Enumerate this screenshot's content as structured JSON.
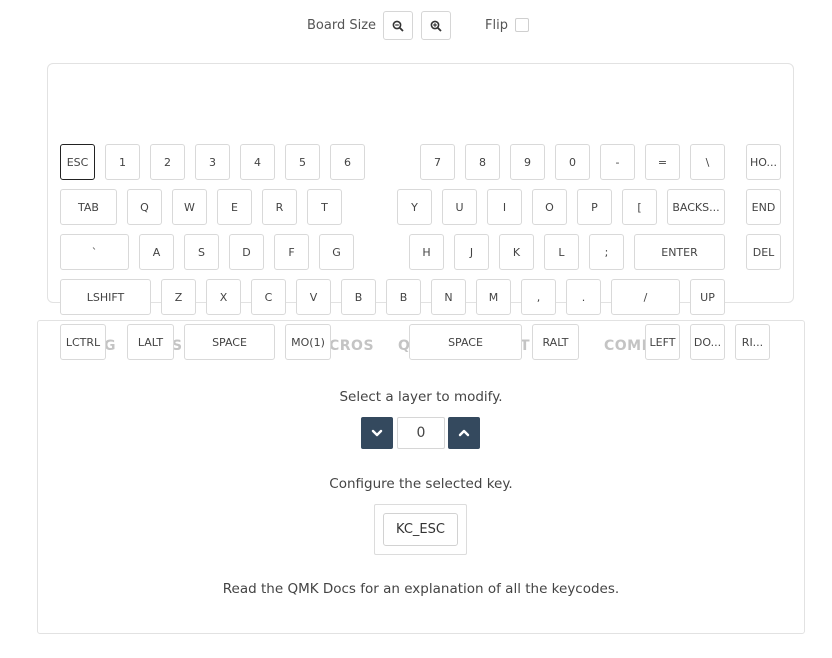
{
  "toolbar": {
    "board_size_label": "Board Size",
    "zoom_out_icon": "zoom-out-icon",
    "zoom_in_icon": "zoom-in-icon",
    "flip_label": "Flip",
    "flip_checked": false
  },
  "keys": [
    "ESC",
    "1",
    "2",
    "3",
    "4",
    "5",
    "6",
    "7",
    "8",
    "9",
    "0",
    "-",
    "=",
    "\\",
    "HO...",
    "TAB",
    "Q",
    "W",
    "E",
    "R",
    "T",
    "Y",
    "U",
    "I",
    "O",
    "P",
    "[",
    "BACKS...",
    "END",
    "`",
    "A",
    "S",
    "D",
    "F",
    "G",
    "H",
    "J",
    "K",
    "L",
    ";",
    "ENTER",
    "DEL",
    "LSHIFT",
    "Z",
    "X",
    "C",
    "V",
    "B",
    "B",
    "N",
    "M",
    ",",
    ".",
    "/",
    "UP",
    "LCTRL",
    "LALT",
    "SPACE",
    "MO(1)",
    "SPACE",
    "RALT",
    "LEFT",
    "DO...",
    "RI..."
  ],
  "tabs": {
    "t1": "G",
    "t2": "S",
    "t3": "CROS",
    "t4": "Q",
    "t5": "T",
    "t6": "COMP"
  },
  "layer": {
    "prompt": "Select a layer to modify.",
    "value": "0",
    "down_icon": "chevron-down-icon",
    "up_icon": "chevron-up-icon"
  },
  "configure": {
    "prompt": "Configure the selected key.",
    "keycode": "KC_ESC"
  },
  "footer_text": "Read the QMK Docs for an explanation of all the keycodes.",
  "colors": {
    "layer_button": "#34495e",
    "selected_key_border": "#222222"
  }
}
